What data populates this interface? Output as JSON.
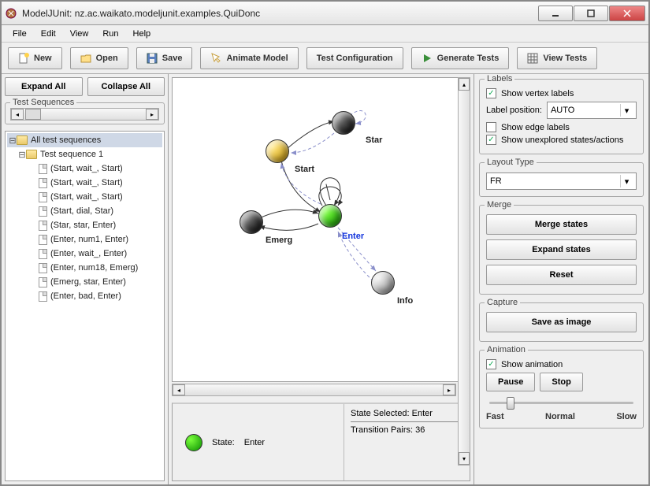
{
  "window": {
    "title": "ModelJUnit: nz.ac.waikato.modeljunit.examples.QuiDonc"
  },
  "menubar": [
    "File",
    "Edit",
    "View",
    "Run",
    "Help"
  ],
  "toolbar": {
    "new": "New",
    "open": "Open",
    "save": "Save",
    "animate": "Animate Model",
    "testConfig": "Test Configuration",
    "genTests": "Generate Tests",
    "viewTests": "View Tests"
  },
  "left": {
    "expandAll": "Expand All",
    "collapseAll": "Collapse All",
    "testSequences": "Test Sequences",
    "tree": {
      "root": "All test sequences",
      "seq1": "Test sequence 1",
      "items": [
        "(Start, wait_, Start)",
        "(Start, wait_, Start)",
        "(Start, wait_, Start)",
        "(Start, dial, Star)",
        "(Star, star, Enter)",
        "(Enter, num1, Enter)",
        "(Enter, wait_, Enter)",
        "(Enter, num18, Emerg)",
        "(Emerg, star, Enter)",
        "(Enter, bad, Enter)"
      ]
    }
  },
  "graph": {
    "nodes": {
      "star": "Star",
      "start": "Start",
      "emerg": "Emerg",
      "enter": "Enter",
      "info": "Info"
    }
  },
  "status": {
    "stateLabel": "State:",
    "stateValue": "Enter",
    "selected": "State Selected: Enter",
    "pairs": "Transition Pairs: 36"
  },
  "right": {
    "labels": {
      "title": "Labels",
      "showVertex": "Show vertex labels",
      "labelPosition": "Label position:",
      "labelPositionValue": "AUTO",
      "showEdge": "Show edge labels",
      "showUnexplored": "Show unexplored states/actions"
    },
    "layout": {
      "title": "Layout Type",
      "value": "FR"
    },
    "merge": {
      "title": "Merge",
      "mergeStates": "Merge states",
      "expandStates": "Expand states",
      "reset": "Reset"
    },
    "capture": {
      "title": "Capture",
      "saveImage": "Save as image"
    },
    "animation": {
      "title": "Animation",
      "show": "Show animation",
      "pause": "Pause",
      "stop": "Stop",
      "fast": "Fast",
      "normal": "Normal",
      "slow": "Slow"
    }
  },
  "checked": {
    "showVertex": true,
    "showEdge": false,
    "showUnexplored": true,
    "showAnimation": true
  }
}
